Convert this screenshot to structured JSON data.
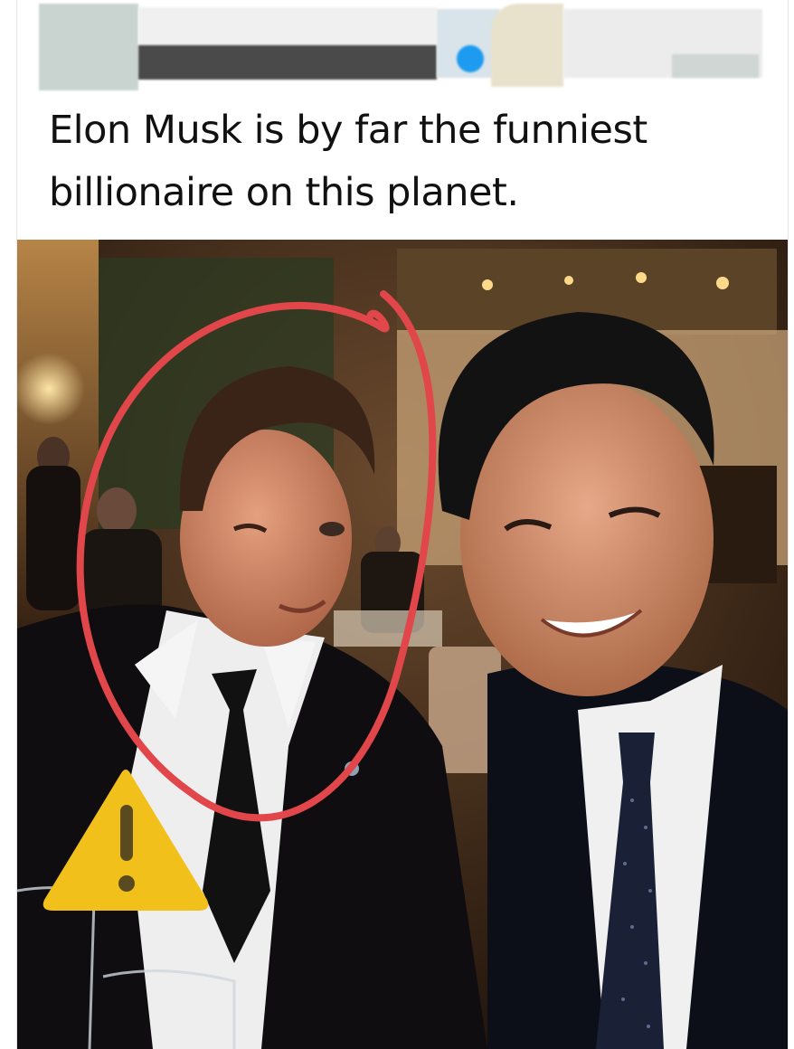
{
  "post": {
    "text": "Elon Musk is by far the funniest billionaire on this planet."
  },
  "colors": {
    "annotation_circle": "#e0464a",
    "warning_icon_fill": "#f2c01b",
    "warning_icon_mark": "#5a4a20",
    "verified_badge": "#1d9bf0"
  },
  "icons": {
    "warning": "warning-triangle-icon",
    "badge": "verified-badge-icon"
  }
}
